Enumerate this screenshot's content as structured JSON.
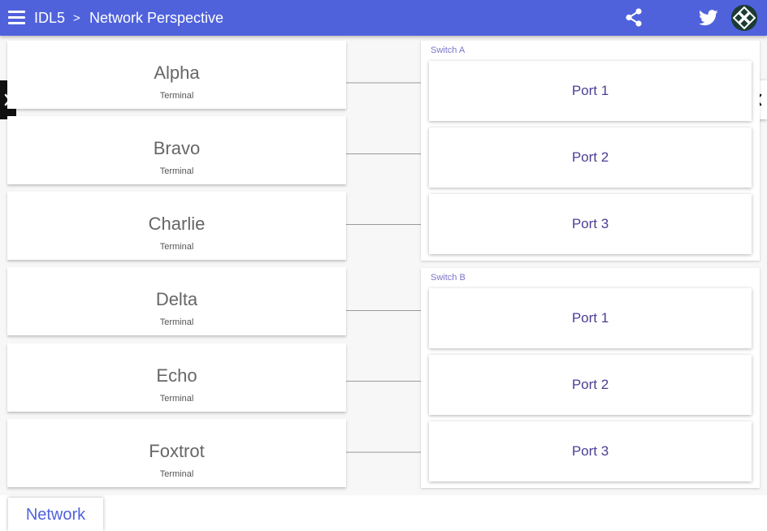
{
  "header": {
    "app_name": "IDL5",
    "separator": ">",
    "page_title": "Network Perspective",
    "bg_color": "#4f62dc",
    "icons": [
      "menu-icon",
      "share-icon",
      "twitter-icon",
      "avatar"
    ]
  },
  "terminals": [
    {
      "name": "Alpha",
      "type": "Terminal"
    },
    {
      "name": "Bravo",
      "type": "Terminal"
    },
    {
      "name": "Charlie",
      "type": "Terminal"
    },
    {
      "name": "Delta",
      "type": "Terminal"
    },
    {
      "name": "Echo",
      "type": "Terminal"
    },
    {
      "name": "Foxtrot",
      "type": "Terminal"
    }
  ],
  "switches": [
    {
      "name": "Switch A",
      "ports": [
        "Port 1",
        "Port 2",
        "Port 3"
      ]
    },
    {
      "name": "Switch B",
      "ports": [
        "Port 1",
        "Port 2",
        "Port 3"
      ]
    }
  ],
  "bottom_tabs": [
    {
      "label": "Network",
      "active": true
    }
  ],
  "colors": {
    "accent": "#4f62dc",
    "port_text": "#4a3f96",
    "switch_label": "#7b74c8"
  }
}
